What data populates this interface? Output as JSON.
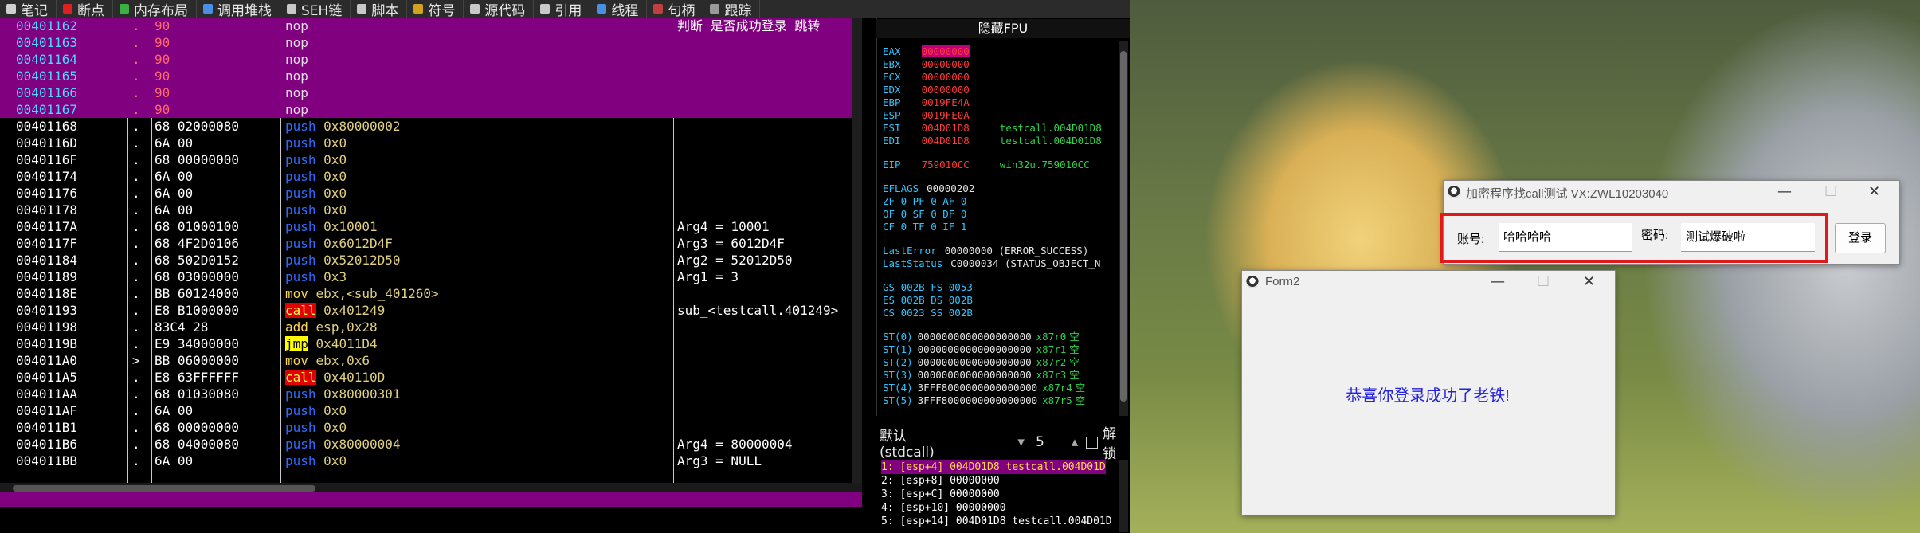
{
  "tabs": [
    {
      "label": "笔记",
      "icon": "note-icon",
      "color": "#d0d0d0"
    },
    {
      "label": "断点",
      "icon": "breakpoint-icon",
      "color": "#e02020"
    },
    {
      "label": "内存布局",
      "icon": "memory-map-icon",
      "color": "#3cb043"
    },
    {
      "label": "调用堆栈",
      "icon": "call-stack-icon",
      "color": "#4a90e2"
    },
    {
      "label": "SEH链",
      "icon": "seh-icon",
      "color": "#c9c9c9"
    },
    {
      "label": "脚本",
      "icon": "script-icon",
      "color": "#c9c9c9"
    },
    {
      "label": "符号",
      "icon": "symbol-icon",
      "color": "#d4a020"
    },
    {
      "label": "源代码",
      "icon": "source-icon",
      "color": "#c9c9c9"
    },
    {
      "label": "引用",
      "icon": "reference-icon",
      "color": "#c9c9c9"
    },
    {
      "label": "线程",
      "icon": "thread-icon",
      "color": "#4a90e2"
    },
    {
      "label": "句柄",
      "icon": "handle-icon",
      "color": "#c04040"
    },
    {
      "label": "跟踪",
      "icon": "trace-icon",
      "color": "#9a9a9a"
    }
  ],
  "disasm": {
    "rows": [
      {
        "addr": "00401162",
        "dot": ".",
        "bytes": "90",
        "mn": "nop",
        "mnClass": "white",
        "op": "",
        "cmt": "判断 是否成功登录 跳转",
        "sel": true
      },
      {
        "addr": "00401163",
        "dot": ".",
        "bytes": "90",
        "mn": "nop",
        "mnClass": "white",
        "op": "",
        "cmt": "",
        "sel": true
      },
      {
        "addr": "00401164",
        "dot": ".",
        "bytes": "90",
        "mn": "nop",
        "mnClass": "white",
        "op": "",
        "cmt": "",
        "sel": true
      },
      {
        "addr": "00401165",
        "dot": ".",
        "bytes": "90",
        "mn": "nop",
        "mnClass": "white",
        "op": "",
        "cmt": "",
        "sel": true
      },
      {
        "addr": "00401166",
        "dot": ".",
        "bytes": "90",
        "mn": "nop",
        "mnClass": "white",
        "op": "",
        "cmt": "",
        "sel": true
      },
      {
        "addr": "00401167",
        "dot": ".",
        "bytes": "90",
        "mn": "nop",
        "mnClass": "white",
        "op": "",
        "cmt": "",
        "sel": true
      },
      {
        "addr": "00401168",
        "dot": ".",
        "bytes": "68 02000080",
        "mn": "push",
        "mnClass": "",
        "op": "0x80000002",
        "cmt": "",
        "sel": false
      },
      {
        "addr": "0040116D",
        "dot": ".",
        "bytes": "6A 00",
        "mn": "push",
        "mnClass": "",
        "op": "0x0",
        "cmt": "",
        "sel": false
      },
      {
        "addr": "0040116F",
        "dot": ".",
        "bytes": "68 00000000",
        "mn": "push",
        "mnClass": "",
        "op": "0x0",
        "cmt": "",
        "sel": false
      },
      {
        "addr": "00401174",
        "dot": ".",
        "bytes": "6A 00",
        "mn": "push",
        "mnClass": "",
        "op": "0x0",
        "cmt": "",
        "sel": false
      },
      {
        "addr": "00401176",
        "dot": ".",
        "bytes": "6A 00",
        "mn": "push",
        "mnClass": "",
        "op": "0x0",
        "cmt": "",
        "sel": false
      },
      {
        "addr": "00401178",
        "dot": ".",
        "bytes": "6A 00",
        "mn": "push",
        "mnClass": "",
        "op": "0x0",
        "cmt": "",
        "sel": false
      },
      {
        "addr": "0040117A",
        "dot": ".",
        "bytes": "68 01000100",
        "mn": "push",
        "mnClass": "",
        "op": "0x10001",
        "cmt": "Arg4 = 10001",
        "sel": false
      },
      {
        "addr": "0040117F",
        "dot": ".",
        "bytes": "68 4F2D0106",
        "mn": "push",
        "mnClass": "",
        "op": "0x6012D4F",
        "cmt": "Arg3 = 6012D4F",
        "sel": false
      },
      {
        "addr": "00401184",
        "dot": ".",
        "bytes": "68 502D0152",
        "mn": "push",
        "mnClass": "",
        "op": "0x52012D50",
        "cmt": "Arg2 = 52012D50",
        "sel": false
      },
      {
        "addr": "00401189",
        "dot": ".",
        "bytes": "68 03000000",
        "mn": "push",
        "mnClass": "",
        "op": "0x3",
        "cmt": "Arg1 = 3",
        "sel": false
      },
      {
        "addr": "0040118E",
        "dot": ".",
        "bytes": "BB 60124000",
        "mn": "mov",
        "mnClass": "yel",
        "op": "ebx,<sub_401260>",
        "cmt": "",
        "sel": false
      },
      {
        "addr": "00401193",
        "dot": ".",
        "bytes": "E8 B1000000",
        "mn": "call",
        "mnClass": "call",
        "op": "0x401249",
        "cmt": "sub_<testcall.401249>",
        "sel": false
      },
      {
        "addr": "00401198",
        "dot": ".",
        "bytes": "83C4 28",
        "mn": "add",
        "mnClass": "yel",
        "op": "esp,0x28",
        "cmt": "",
        "sel": false
      },
      {
        "addr": "0040119B",
        "dot": ".",
        "bytes": "E9 34000000",
        "mn": "jmp",
        "mnClass": "jmp",
        "op": "0x4011D4",
        "cmt": "",
        "sel": false
      },
      {
        "addr": "004011A0",
        "dot": ">",
        "bytes": "BB 06000000",
        "mn": "mov",
        "mnClass": "yel",
        "op": "ebx,0x6",
        "cmt": "",
        "sel": false
      },
      {
        "addr": "004011A5",
        "dot": ".",
        "bytes": "E8 63FFFFFF",
        "mn": "call",
        "mnClass": "call",
        "op": "0x40110D",
        "cmt": "",
        "sel": false
      },
      {
        "addr": "004011AA",
        "dot": ".",
        "bytes": "68 01030080",
        "mn": "push",
        "mnClass": "",
        "op": "0x80000301",
        "cmt": "",
        "sel": false
      },
      {
        "addr": "004011AF",
        "dot": ".",
        "bytes": "6A 00",
        "mn": "push",
        "mnClass": "",
        "op": "0x0",
        "cmt": "",
        "sel": false
      },
      {
        "addr": "004011B1",
        "dot": ".",
        "bytes": "68 00000000",
        "mn": "push",
        "mnClass": "",
        "op": "0x0",
        "cmt": "",
        "sel": false
      },
      {
        "addr": "004011B6",
        "dot": ".",
        "bytes": "68 04000080",
        "mn": "push",
        "mnClass": "",
        "op": "0x80000004",
        "cmt": "Arg4 = 80000004",
        "sel": false
      },
      {
        "addr": "004011BB",
        "dot": ".",
        "bytes": "6A 00",
        "mn": "push",
        "mnClass": "",
        "op": "0x0",
        "cmt": "Arg3 = NULL",
        "sel": false
      }
    ]
  },
  "registers": {
    "title": "隐藏FPU",
    "gpr": [
      {
        "name": "EAX",
        "val": "00000000",
        "hl": true,
        "cmt": ""
      },
      {
        "name": "EBX",
        "val": "00000000",
        "hl": false,
        "cmt": ""
      },
      {
        "name": "ECX",
        "val": "00000000",
        "hl": false,
        "cmt": ""
      },
      {
        "name": "EDX",
        "val": "00000000",
        "hl": false,
        "cmt": ""
      },
      {
        "name": "EBP",
        "val": "0019FE4A",
        "hl": false,
        "cmt": ""
      },
      {
        "name": "ESP",
        "val": "0019FE0A",
        "hl": false,
        "cmt": ""
      },
      {
        "name": "ESI",
        "val": "004D01D8",
        "hl": false,
        "cmt": "testcall.004D01D8"
      },
      {
        "name": "EDI",
        "val": "004D01D8",
        "hl": false,
        "cmt": "testcall.004D01D8"
      }
    ],
    "eip": {
      "name": "EIP",
      "val": "759010CC",
      "cmt": "win32u.759010CC"
    },
    "eflags": {
      "name": "EFLAGS",
      "val": "00000202"
    },
    "flags": [
      "ZF 0  PF 0  AF 0",
      "OF 0  SF 0  DF 0",
      "CF 0  TF 0  IF 1"
    ],
    "lasterror": {
      "name": "LastError",
      "val": "00000000 (ERROR_SUCCESS)"
    },
    "laststatus": {
      "name": "LastStatus",
      "val": "C0000034 (STATUS_OBJECT_N"
    },
    "segs": [
      "GS 002B  FS 0053",
      "ES 002B  DS 002B",
      "CS 0023  SS 002B"
    ],
    "fpu": [
      {
        "name": "ST(0)",
        "val": "0000000000000000000",
        "tag": "x87r0",
        "state": "空"
      },
      {
        "name": "ST(1)",
        "val": "0000000000000000000",
        "tag": "x87r1",
        "state": "空"
      },
      {
        "name": "ST(2)",
        "val": "0000000000000000000",
        "tag": "x87r2",
        "state": "空"
      },
      {
        "name": "ST(3)",
        "val": "0000000000000000000",
        "tag": "x87r3",
        "state": "空"
      },
      {
        "name": "ST(4)",
        "val": "3FFF8000000000000000",
        "tag": "x87r4",
        "state": "空"
      },
      {
        "name": "ST(5)",
        "val": "3FFF8000000000000000",
        "tag": "x87r5",
        "state": "空"
      }
    ]
  },
  "callconv": {
    "selected": "默认 (stdcall)",
    "count": "5",
    "unlock_label": "解锁"
  },
  "stack": [
    {
      "text": "1: [esp+4]  004D01D8 testcall.004D01D",
      "sel": true
    },
    {
      "text": "2: [esp+8]  00000000",
      "sel": false
    },
    {
      "text": "3: [esp+C]  00000000",
      "sel": false
    },
    {
      "text": "4: [esp+10] 00000000",
      "sel": false
    },
    {
      "text": "5: [esp+14] 004D01D8 testcall.004D01D",
      "sel": false
    }
  ],
  "login_window": {
    "title": "加密程序找call测试   VX:ZWL10203040",
    "account_label": "账号:",
    "account_value": "哈哈哈哈",
    "password_label": "密码:",
    "password_value": "测试爆破啦",
    "login_button": "登录"
  },
  "form2": {
    "title": "Form2",
    "message": "恭喜你登录成功了老铁!"
  },
  "window_controls": {
    "minimize": "—",
    "maximize": "☐",
    "close": "✕"
  },
  "colors": {
    "selection": "#800080",
    "call": "#e00000",
    "jmp": "#ffff00",
    "highlight_box": "#e0191b",
    "success_text": "#2222e0"
  }
}
